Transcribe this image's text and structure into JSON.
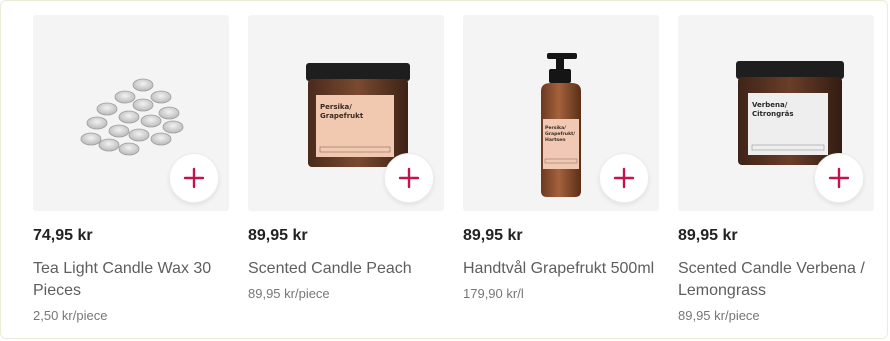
{
  "products": [
    {
      "price": "74,95 kr",
      "name": "Tea Light Candle Wax 30 Pieces",
      "unit_price": "2,50 kr/piece",
      "image_icon": "tealight-candles-image"
    },
    {
      "price": "89,95 kr",
      "name": "Scented Candle Peach",
      "unit_price": "89,95 kr/piece",
      "image_icon": "scented-candle-jar-image",
      "label_lines": [
        "Persika/",
        "Grapefrukt"
      ]
    },
    {
      "price": "89,95 kr",
      "name": "Handtvål Grapefrukt 500ml",
      "unit_price": "179,90 kr/l",
      "image_icon": "soap-pump-bottle-image",
      "label_lines": [
        "Persika/",
        "Grapefrukt/",
        "Hartsen"
      ]
    },
    {
      "price": "89,95 kr",
      "name": "Scented Candle Verbena / Lemongrass",
      "unit_price": "89,95 kr/piece",
      "image_icon": "scented-candle-jar-image",
      "label_lines": [
        "Verbena/",
        "Citrongräs"
      ]
    }
  ],
  "add_button_icon": "plus-icon",
  "accent_color": "#c3144e"
}
